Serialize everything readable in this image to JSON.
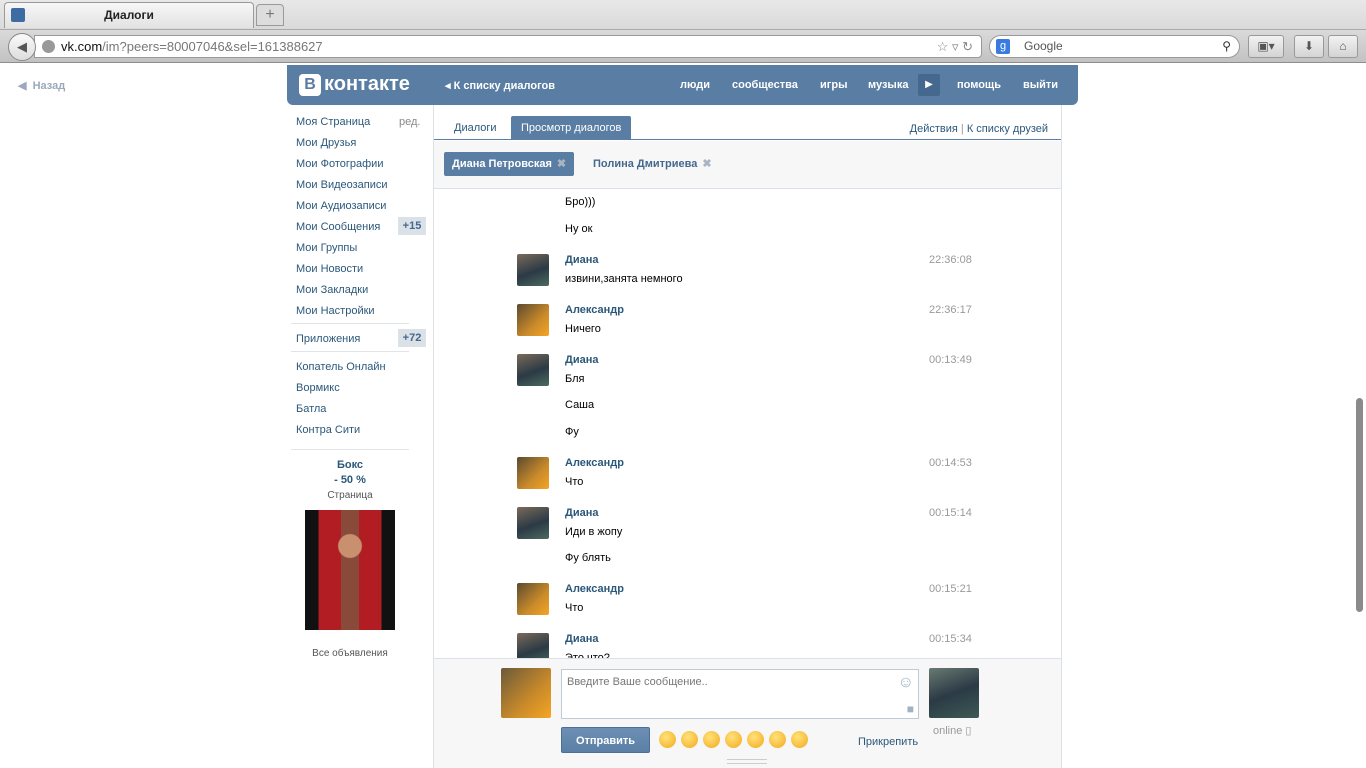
{
  "browser": {
    "tab_title": "Диалоги",
    "url_host": "vk.com",
    "url_path": "/im?peers=80007046&sel=161388627",
    "search_placeholder": "Google"
  },
  "page": {
    "back_label": "Назад"
  },
  "header": {
    "logo": "контакте",
    "logo_letter": "В",
    "back_to_dialogs": "К списку диалогов",
    "nav": [
      "люди",
      "сообщества",
      "игры",
      "музыка",
      "помощь",
      "выйти"
    ]
  },
  "sidebar": {
    "edit": "ред.",
    "items": [
      "Моя Страница",
      "Мои Друзья",
      "Мои Фотографии",
      "Мои Видеозаписи",
      "Мои Аудиозаписи",
      "Мои Сообщения",
      "Мои Группы",
      "Мои Новости",
      "Мои Закладки",
      "Мои Настройки"
    ],
    "messages_count": "+15",
    "apps_label": "Приложения",
    "apps_count": "+72",
    "apps": [
      "Копатель Онлайн",
      "Вормикс",
      "Батла",
      "Контра Сити"
    ],
    "ad": {
      "title": "Бокс",
      "subtitle": "- 50 %",
      "type": "Страница",
      "all_ads": "Все объявления"
    }
  },
  "tabs": {
    "dialogs": "Диалоги",
    "view": "Просмотр диалогов",
    "actions": "Действия",
    "sep": "|",
    "friends": "К списку друзей"
  },
  "peers": [
    "Диана Петровская",
    "Полина Дмитриева"
  ],
  "messages": [
    {
      "name": "",
      "time": "",
      "lines": [
        "Бро)))",
        "Ну ок"
      ]
    },
    {
      "name": "Диана",
      "time": "22:36:08",
      "lines": [
        "извини,занята немного"
      ],
      "who": "d"
    },
    {
      "name": "Александр",
      "time": "22:36:17",
      "lines": [
        "Ничего"
      ],
      "who": "a"
    },
    {
      "name": "Диана",
      "time": "00:13:49",
      "lines": [
        "Бля",
        "Саша",
        "Фу"
      ],
      "who": "d"
    },
    {
      "name": "Александр",
      "time": "00:14:53",
      "lines": [
        "Что"
      ],
      "who": "a"
    },
    {
      "name": "Диана",
      "time": "00:15:14",
      "lines": [
        "Иди в жопу",
        "Фу блять"
      ],
      "who": "d"
    },
    {
      "name": "Александр",
      "time": "00:15:21",
      "lines": [
        "Что"
      ],
      "who": "a"
    },
    {
      "name": "Диана",
      "time": "00:15:34",
      "lines": [
        "Это что?"
      ],
      "who": "d"
    }
  ],
  "composer": {
    "placeholder": "Введите Ваше сообщение..",
    "send": "Отправить",
    "attach": "Прикрепить",
    "status": "online"
  }
}
